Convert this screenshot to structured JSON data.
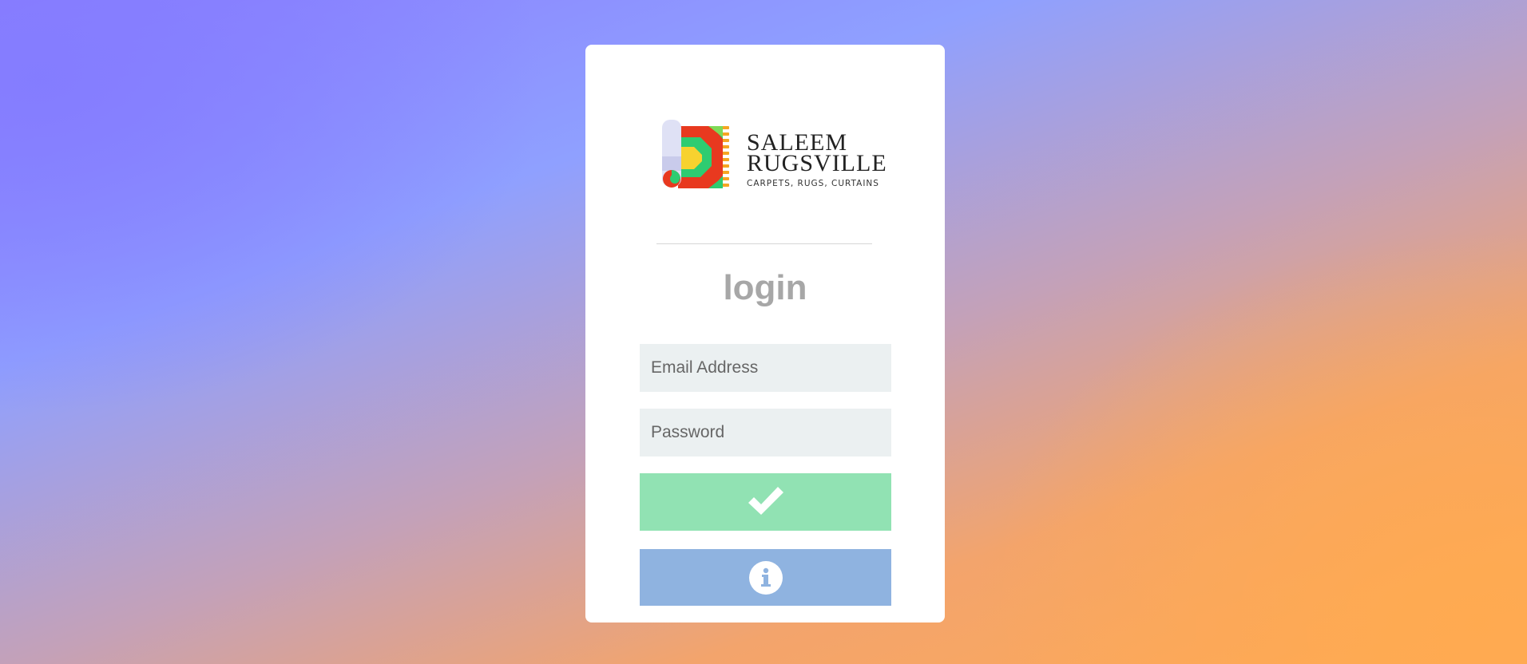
{
  "brand": {
    "name_line1": "SALEEM",
    "name_line2": "RUGSVILLE",
    "tagline": "CARPETS, RUGS, CURTAINS"
  },
  "login": {
    "title": "login",
    "email_placeholder": "Email Address",
    "password_placeholder": "Password",
    "submit_icon": "check-icon",
    "info_icon": "info-icon"
  },
  "colors": {
    "submit_button": "#91e2b3",
    "info_button": "#8fb3e0",
    "input_background": "#ebf0f1",
    "title_text": "#a7a7a7"
  }
}
